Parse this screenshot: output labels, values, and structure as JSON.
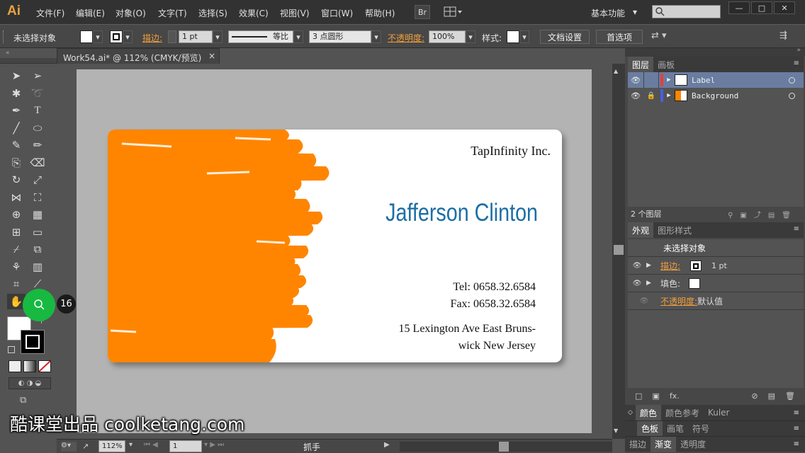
{
  "app": {
    "logo": "Ai"
  },
  "menu": [
    "文件(F)",
    "编辑(E)",
    "对象(O)",
    "文字(T)",
    "选择(S)",
    "效果(C)",
    "视图(V)",
    "窗口(W)",
    "帮助(H)"
  ],
  "menubar": {
    "br_label": "Br",
    "workspace": "基本功能",
    "workspace_arrow": "▾",
    "search_placeholder": ""
  },
  "window_controls": {
    "minimize": "—",
    "maximize": "□",
    "close": "✕"
  },
  "control": {
    "no_selection": "未选择对象",
    "stroke_label": "描边:",
    "stroke_value": "1 pt",
    "profile": "等比",
    "brush": "3 点圆形",
    "opacity_label": "不透明度:",
    "opacity_value": "100%",
    "style_label": "样式:",
    "doc_setup": "文档设置",
    "prefs": "首选项"
  },
  "document": {
    "tab_title": "Work54.ai* @ 112% (CMYK/预览)",
    "close": "×"
  },
  "card": {
    "company": "TapInfinity Inc.",
    "person": "Jafferson Clinton",
    "tel": "Tel:  0658.32.6584",
    "fax": "Fax:  0658.32.6584",
    "address1": "15 Lexington Ave East Bruns-",
    "address2": "wick  New Jersey",
    "accent": "#ff8500",
    "name_color": "#1c6ea4"
  },
  "status": {
    "zoom": "112%",
    "page": "1",
    "tool": "抓手"
  },
  "layers_panel": {
    "tab_layers": "图层",
    "tab_artboards": "画板",
    "layers": [
      {
        "name": "Label",
        "color": "#e04040"
      },
      {
        "name": "Background",
        "color": "#4a5ee0"
      }
    ],
    "count": "2 个图层"
  },
  "appearance_panel": {
    "tab_appearance": "外观",
    "tab_graphic_styles": "图形样式",
    "title": "未选择对象",
    "stroke_label": "描边:",
    "stroke_value": "1 pt",
    "fill_label": "填色:",
    "opacity_label": "不透明度:",
    "opacity_value": "默认值",
    "fx": "fx."
  },
  "bottom_panels": {
    "row1": [
      "颜色",
      "颜色参考",
      "Kuler"
    ],
    "row2": [
      "色板",
      "画笔",
      "符号"
    ],
    "row3": [
      "描边",
      "渐变",
      "透明度"
    ]
  },
  "overlay": {
    "watermark": "酷课堂出品 coolketang.com",
    "step": "16"
  }
}
